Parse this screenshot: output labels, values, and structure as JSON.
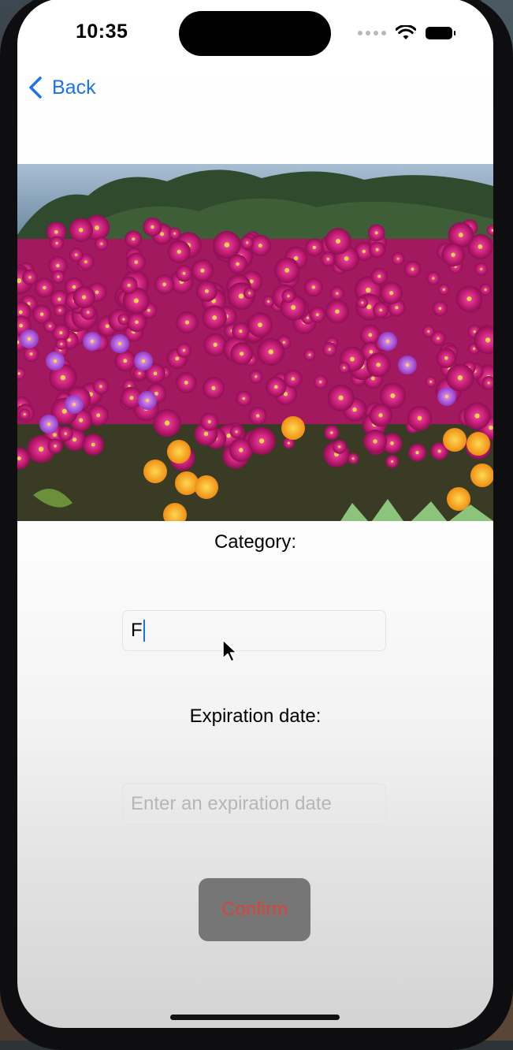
{
  "status_bar": {
    "time": "10:35",
    "icons": [
      "signal-dots-icon",
      "wifi-icon",
      "battery-icon"
    ]
  },
  "nav": {
    "back_label": "Back",
    "back_icon": "chevron-left-icon",
    "accent_color": "#1a73e8"
  },
  "form": {
    "category_label": "Category:",
    "category_value": "F",
    "expiration_label": "Expiration date:",
    "expiration_placeholder": "Enter an expiration date",
    "confirm_label": "Confirm"
  },
  "colors": {
    "confirm_text": "#d8443a",
    "confirm_bg": "#767676"
  }
}
